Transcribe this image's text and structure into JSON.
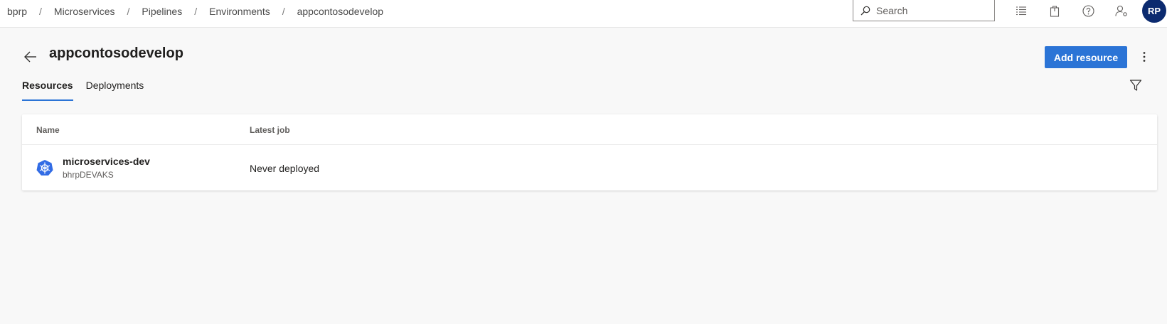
{
  "breadcrumb": [
    "bprp",
    "Microservices",
    "Pipelines",
    "Environments",
    "appcontosodevelop"
  ],
  "search": {
    "placeholder": "Search"
  },
  "toolbar_icons": [
    "list-icon",
    "bag-icon",
    "help-icon",
    "user-settings-icon"
  ],
  "user": {
    "initials": "RP"
  },
  "page": {
    "title": "appcontosodevelop",
    "add_button": "Add resource"
  },
  "tabs": [
    {
      "label": "Resources",
      "active": true
    },
    {
      "label": "Deployments",
      "active": false
    }
  ],
  "table": {
    "columns": [
      "Name",
      "Latest job"
    ],
    "rows": [
      {
        "name": "microservices-dev",
        "subtitle": "bhrpDEVAKS",
        "latest_job": "Never deployed",
        "icon": "kubernetes-icon"
      }
    ]
  },
  "colors": {
    "accent": "#2b74d6",
    "avatar": "#0b2a6f",
    "kubernetes": "#326ce5"
  }
}
